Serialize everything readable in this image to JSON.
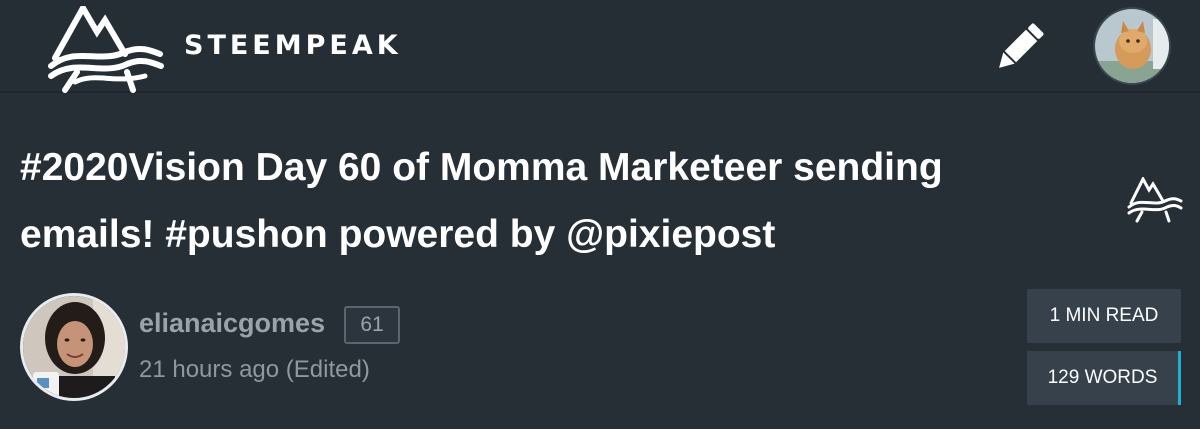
{
  "header": {
    "brand_name": "STEEMPEAK",
    "icons": {
      "logo": "steempeak-mountain-logo",
      "edit": "pencil-icon",
      "user": "user-avatar-cat"
    }
  },
  "post": {
    "title": "#2020Vision Day 60 of Momma Marketeer sending emails! #pushon powered by @pixiepost",
    "author": {
      "name": "elianaicgomes",
      "reputation": "61",
      "time": "21 hours ago (Edited)"
    },
    "stats": {
      "read_time": "1 MIN READ",
      "word_count": "129 WORDS"
    }
  },
  "colors": {
    "background": "#262e36",
    "text_primary": "#ffffff",
    "text_muted": "#9aa2aa",
    "stat_box": "#36414b",
    "accent": "#1fb0d0"
  }
}
